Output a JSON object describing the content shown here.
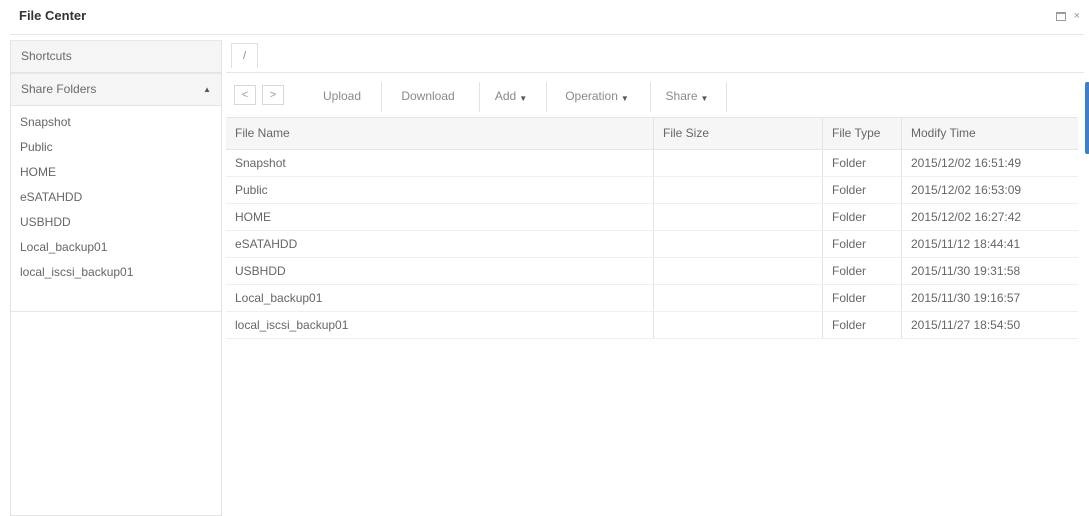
{
  "window": {
    "title": "File Center",
    "restore_icon": "maximize-icon",
    "close_glyph": "×"
  },
  "sidebar": {
    "shortcuts_label": "Shortcuts",
    "share_folders_label": "Share Folders",
    "share_folders_arrow": "▲",
    "items": [
      {
        "label": "Snapshot"
      },
      {
        "label": "Public"
      },
      {
        "label": "HOME"
      },
      {
        "label": "eSATAHDD"
      },
      {
        "label": "USBHDD"
      },
      {
        "label": "Local_backup01"
      },
      {
        "label": "local_iscsi_backup01"
      }
    ]
  },
  "path": {
    "root": "/"
  },
  "toolbar": {
    "back": "<",
    "forward": ">",
    "upload": "Upload",
    "download": "Download",
    "add": "Add",
    "operation": "Operation",
    "share": "Share",
    "caret": "▼"
  },
  "table": {
    "headers": {
      "name": "File Name",
      "size": "File Size",
      "type": "File Type",
      "modified": "Modify Time"
    },
    "rows": [
      {
        "name": "Snapshot",
        "size": "",
        "type": "Folder",
        "modified": "2015/12/02 16:51:49"
      },
      {
        "name": "Public",
        "size": "",
        "type": "Folder",
        "modified": "2015/12/02 16:53:09"
      },
      {
        "name": "HOME",
        "size": "",
        "type": "Folder",
        "modified": "2015/12/02 16:27:42"
      },
      {
        "name": "eSATAHDD",
        "size": "",
        "type": "Folder",
        "modified": "2015/11/12 18:44:41"
      },
      {
        "name": "USBHDD",
        "size": "",
        "type": "Folder",
        "modified": "2015/11/30 19:31:58"
      },
      {
        "name": "Local_backup01",
        "size": "",
        "type": "Folder",
        "modified": "2015/11/30 19:16:57"
      },
      {
        "name": "local_iscsi_backup01",
        "size": "",
        "type": "Folder",
        "modified": "2015/11/27 18:54:50"
      }
    ]
  },
  "colors": {
    "accent": "#3d7fcb",
    "header_bg": "#f6f6f6",
    "border": "#e3e3e3"
  }
}
